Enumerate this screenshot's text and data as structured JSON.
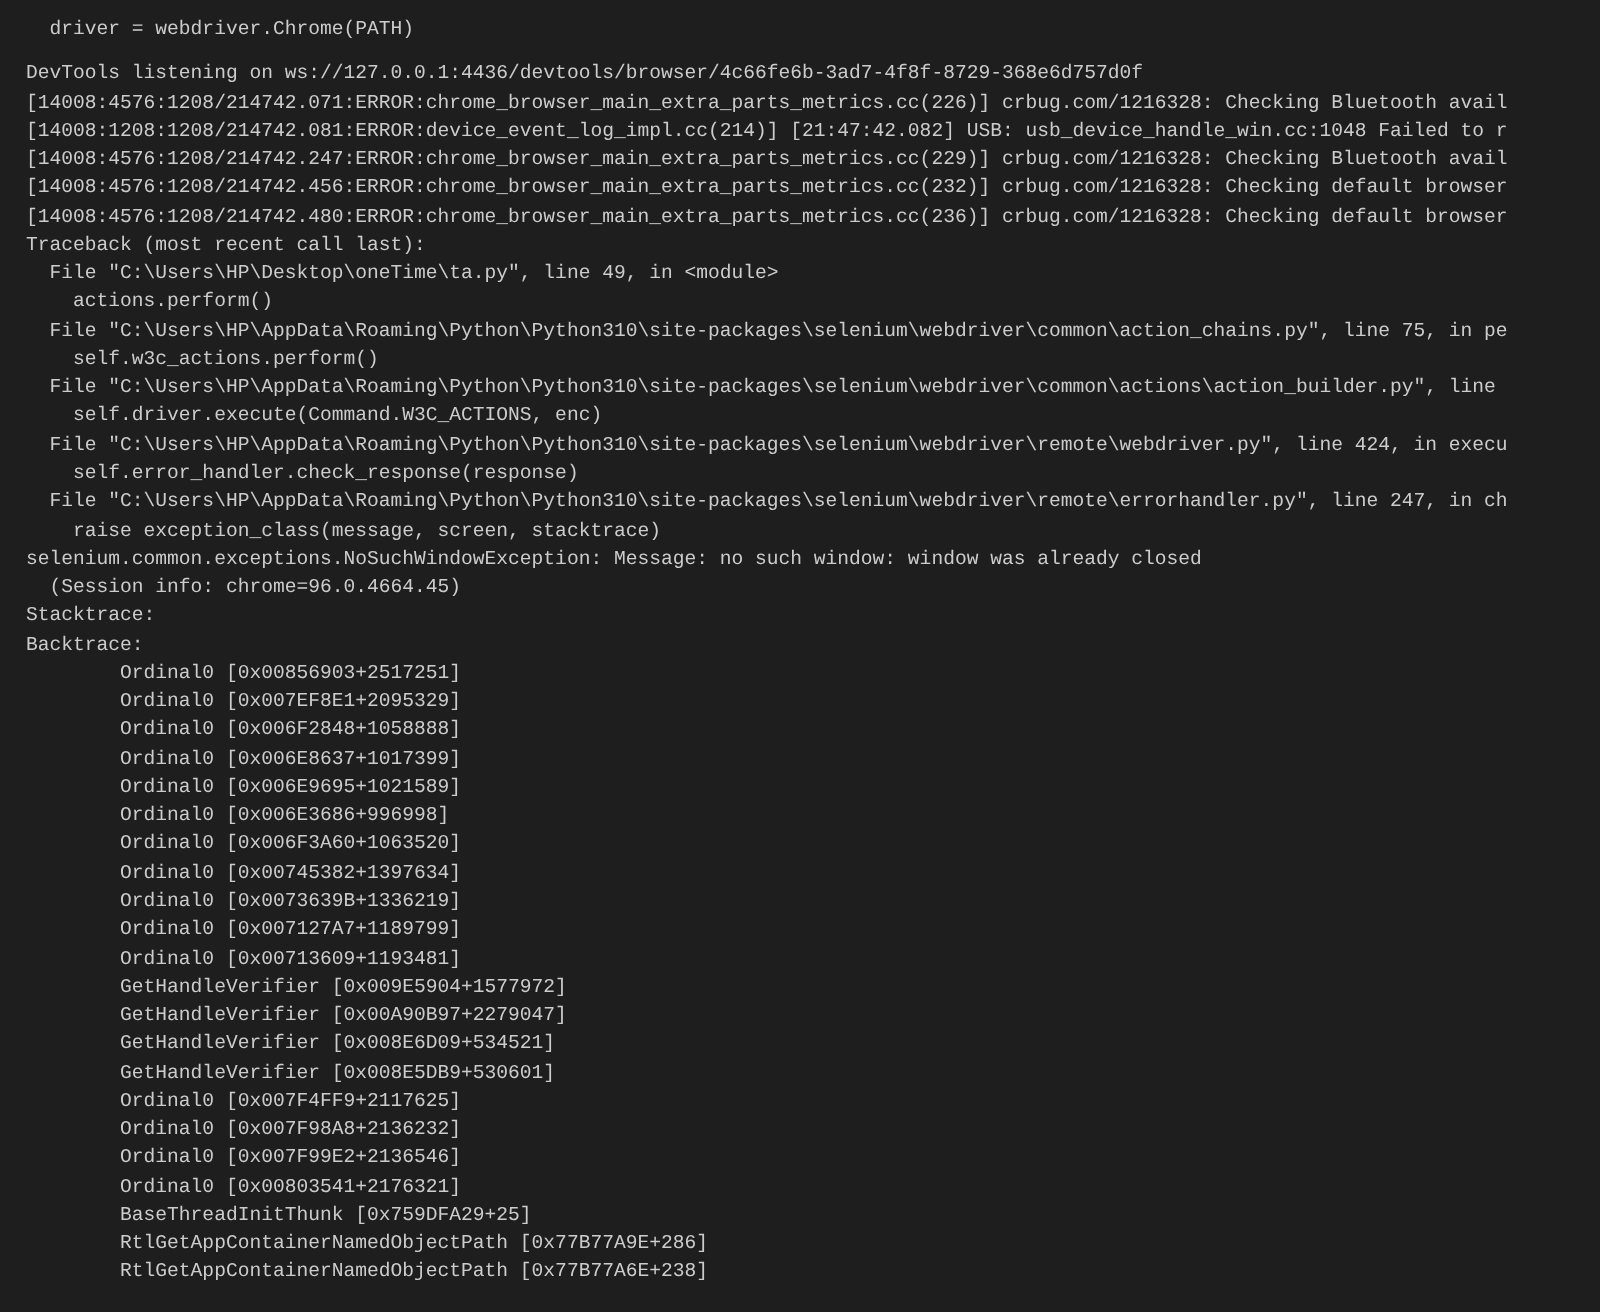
{
  "terminal": {
    "blocks": [
      {
        "lines": [
          "  driver = webdriver.Chrome(PATH)"
        ]
      },
      {
        "lines": [
          "DevTools listening on ws://127.0.0.1:4436/devtools/browser/4c66fe6b-3ad7-4f8f-8729-368e6d757d0f",
          "[14008:4576:1208/214742.071:ERROR:chrome_browser_main_extra_parts_metrics.cc(226)] crbug.com/1216328: Checking Bluetooth avail",
          "[14008:1208:1208/214742.081:ERROR:device_event_log_impl.cc(214)] [21:47:42.082] USB: usb_device_handle_win.cc:1048 Failed to r",
          "[14008:4576:1208/214742.247:ERROR:chrome_browser_main_extra_parts_metrics.cc(229)] crbug.com/1216328: Checking Bluetooth avail",
          "[14008:4576:1208/214742.456:ERROR:chrome_browser_main_extra_parts_metrics.cc(232)] crbug.com/1216328: Checking default browser",
          "[14008:4576:1208/214742.480:ERROR:chrome_browser_main_extra_parts_metrics.cc(236)] crbug.com/1216328: Checking default browser",
          "Traceback (most recent call last):",
          "  File \"C:\\Users\\HP\\Desktop\\oneTime\\ta.py\", line 49, in <module>",
          "    actions.perform()",
          "  File \"C:\\Users\\HP\\AppData\\Roaming\\Python\\Python310\\site-packages\\selenium\\webdriver\\common\\action_chains.py\", line 75, in pe",
          "    self.w3c_actions.perform()",
          "  File \"C:\\Users\\HP\\AppData\\Roaming\\Python\\Python310\\site-packages\\selenium\\webdriver\\common\\actions\\action_builder.py\", line",
          "    self.driver.execute(Command.W3C_ACTIONS, enc)",
          "  File \"C:\\Users\\HP\\AppData\\Roaming\\Python\\Python310\\site-packages\\selenium\\webdriver\\remote\\webdriver.py\", line 424, in execu",
          "    self.error_handler.check_response(response)",
          "  File \"C:\\Users\\HP\\AppData\\Roaming\\Python\\Python310\\site-packages\\selenium\\webdriver\\remote\\errorhandler.py\", line 247, in ch",
          "    raise exception_class(message, screen, stacktrace)",
          "selenium.common.exceptions.NoSuchWindowException: Message: no such window: window was already closed",
          "  (Session info: chrome=96.0.4664.45)",
          "Stacktrace:",
          "Backtrace:",
          "        Ordinal0 [0x00856903+2517251]",
          "        Ordinal0 [0x007EF8E1+2095329]",
          "        Ordinal0 [0x006F2848+1058888]",
          "        Ordinal0 [0x006E8637+1017399]",
          "        Ordinal0 [0x006E9695+1021589]",
          "        Ordinal0 [0x006E3686+996998]",
          "        Ordinal0 [0x006F3A60+1063520]",
          "        Ordinal0 [0x00745382+1397634]",
          "        Ordinal0 [0x0073639B+1336219]",
          "        Ordinal0 [0x007127A7+1189799]",
          "        Ordinal0 [0x00713609+1193481]",
          "        GetHandleVerifier [0x009E5904+1577972]",
          "        GetHandleVerifier [0x00A90B97+2279047]",
          "        GetHandleVerifier [0x008E6D09+534521]",
          "        GetHandleVerifier [0x008E5DB9+530601]",
          "        Ordinal0 [0x007F4FF9+2117625]",
          "        Ordinal0 [0x007F98A8+2136232]",
          "        Ordinal0 [0x007F99E2+2136546]",
          "        Ordinal0 [0x00803541+2176321]",
          "        BaseThreadInitThunk [0x759DFA29+25]",
          "        RtlGetAppContainerNamedObjectPath [0x77B77A9E+286]",
          "        RtlGetAppContainerNamedObjectPath [0x77B77A6E+238]"
        ]
      }
    ]
  }
}
